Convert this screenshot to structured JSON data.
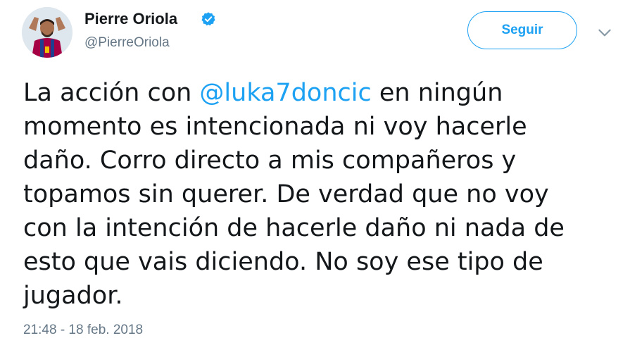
{
  "author": {
    "display_name": "Pierre Oriola",
    "handle": "@PierreOriola",
    "verified": true,
    "avatar_icon": "player-avatar"
  },
  "actions": {
    "follow_label": "Seguir",
    "more_icon": "chevron-down-icon"
  },
  "tweet": {
    "text_before": "La acción con ",
    "mention": "@luka7doncic",
    "text_after": " en ningún momento es intencionada ni voy hacerle daño. Corro directo a mis compañeros y topamos sin querer. De verdad que no voy con la intención de hacerle daño ni nada de esto que vais diciendo. No soy ese tipo de jugador.",
    "timestamp": "21:48 - 18 feb. 2018"
  },
  "colors": {
    "accent": "#1da1f2",
    "text": "#14171a",
    "muted": "#657786"
  }
}
